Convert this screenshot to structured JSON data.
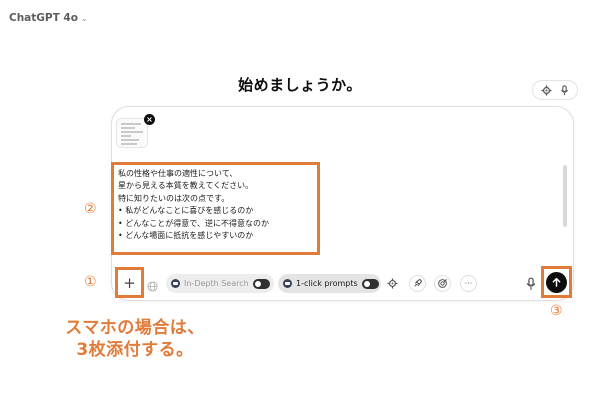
{
  "header": {
    "model_name": "ChatGPT 4o",
    "model_chevron_icon": "chevron-down-icon"
  },
  "main": {
    "headline": "始めましょうか。"
  },
  "top_tools": {
    "icons": [
      "gear-icon",
      "mic-icon"
    ]
  },
  "composer": {
    "attachment": {
      "type": "image-thumbnail",
      "remove_label": "×"
    },
    "prompt_lines": [
      "私の性格や仕事の適性について、",
      "星から見える本質を教えてください。",
      "特に知りたいのは次の点です。",
      "• 私がどんなことに喜びを感じるのか",
      "• どんなことが得意で、逆に不得意なのか",
      "• どんな場面に抵抗を感じやすいのか"
    ],
    "toolbar": {
      "add_label": "+",
      "globe_icon": "globe-icon",
      "in_depth_search_label": "In-Depth Search",
      "one_click_prompts_label": "1-click prompts",
      "tool_icons": [
        "gear-icon",
        "rocket-icon",
        "target-icon",
        "more-icon"
      ],
      "more_label": "···",
      "mic_icon": "mic-icon",
      "send_icon": "arrow-up-icon"
    }
  },
  "annotations": {
    "marker_1": "①",
    "marker_2": "②",
    "marker_3": "③",
    "caption_line1": "スマホの場合は、",
    "caption_line2": "3枚添付する。",
    "accent_color": "#e07b39"
  }
}
